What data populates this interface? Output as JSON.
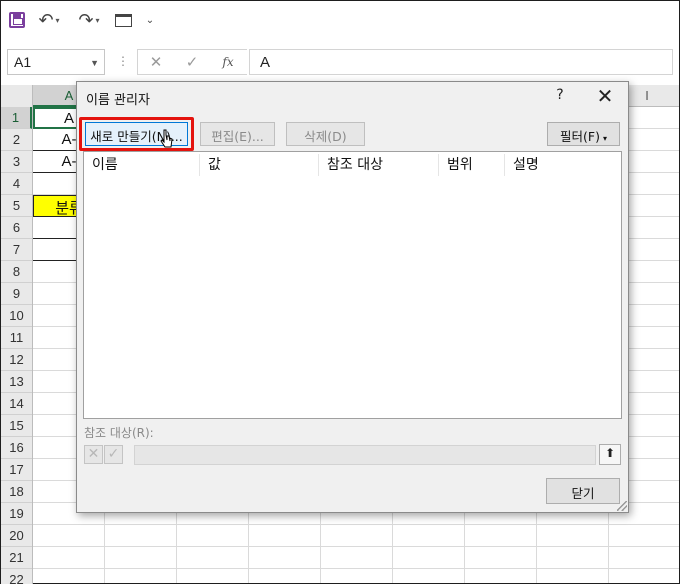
{
  "toolbar": {
    "undo_glyph": "↶",
    "redo_glyph": "↷",
    "more_glyph": "⌄"
  },
  "formula_bar": {
    "name_box": "A1",
    "cancel_glyph": "✕",
    "enter_glyph": "✓",
    "fx_label": "fx",
    "formula_value": "A"
  },
  "sheet": {
    "active_column": "A",
    "visible_column_far_right": "I",
    "rows": [
      "1",
      "2",
      "3",
      "4",
      "5",
      "6",
      "7",
      "8",
      "9",
      "10",
      "11",
      "12",
      "13",
      "14",
      "15",
      "16",
      "17",
      "18",
      "19",
      "20",
      "21",
      "22"
    ],
    "selected_row": "1",
    "cells": {
      "a1": "A",
      "a2": "A-",
      "a3": "A-",
      "a5": "분류"
    }
  },
  "dialog": {
    "title": "이름 관리자",
    "help": "?",
    "close_glyph": "✕",
    "new_button": "새로 만들기(N)...",
    "edit_button": "편집(E)...",
    "delete_button": "삭제(D)",
    "filter_button": "필터(F)",
    "filter_arrow": "▾",
    "columns": [
      "이름",
      "값",
      "참조 대상",
      "범위",
      "설명"
    ],
    "refers_to_label": "참조 대상(R):",
    "cancel_ref_glyph": "✕",
    "accept_ref_glyph": "✓",
    "collapse_glyph": "⬆",
    "close_button": "닫기"
  },
  "colors": {
    "excel_green": "#217346",
    "highlight_red": "#e4130d",
    "yellow_fill": "#ffff00",
    "save_icon": "#7b3f9e"
  }
}
